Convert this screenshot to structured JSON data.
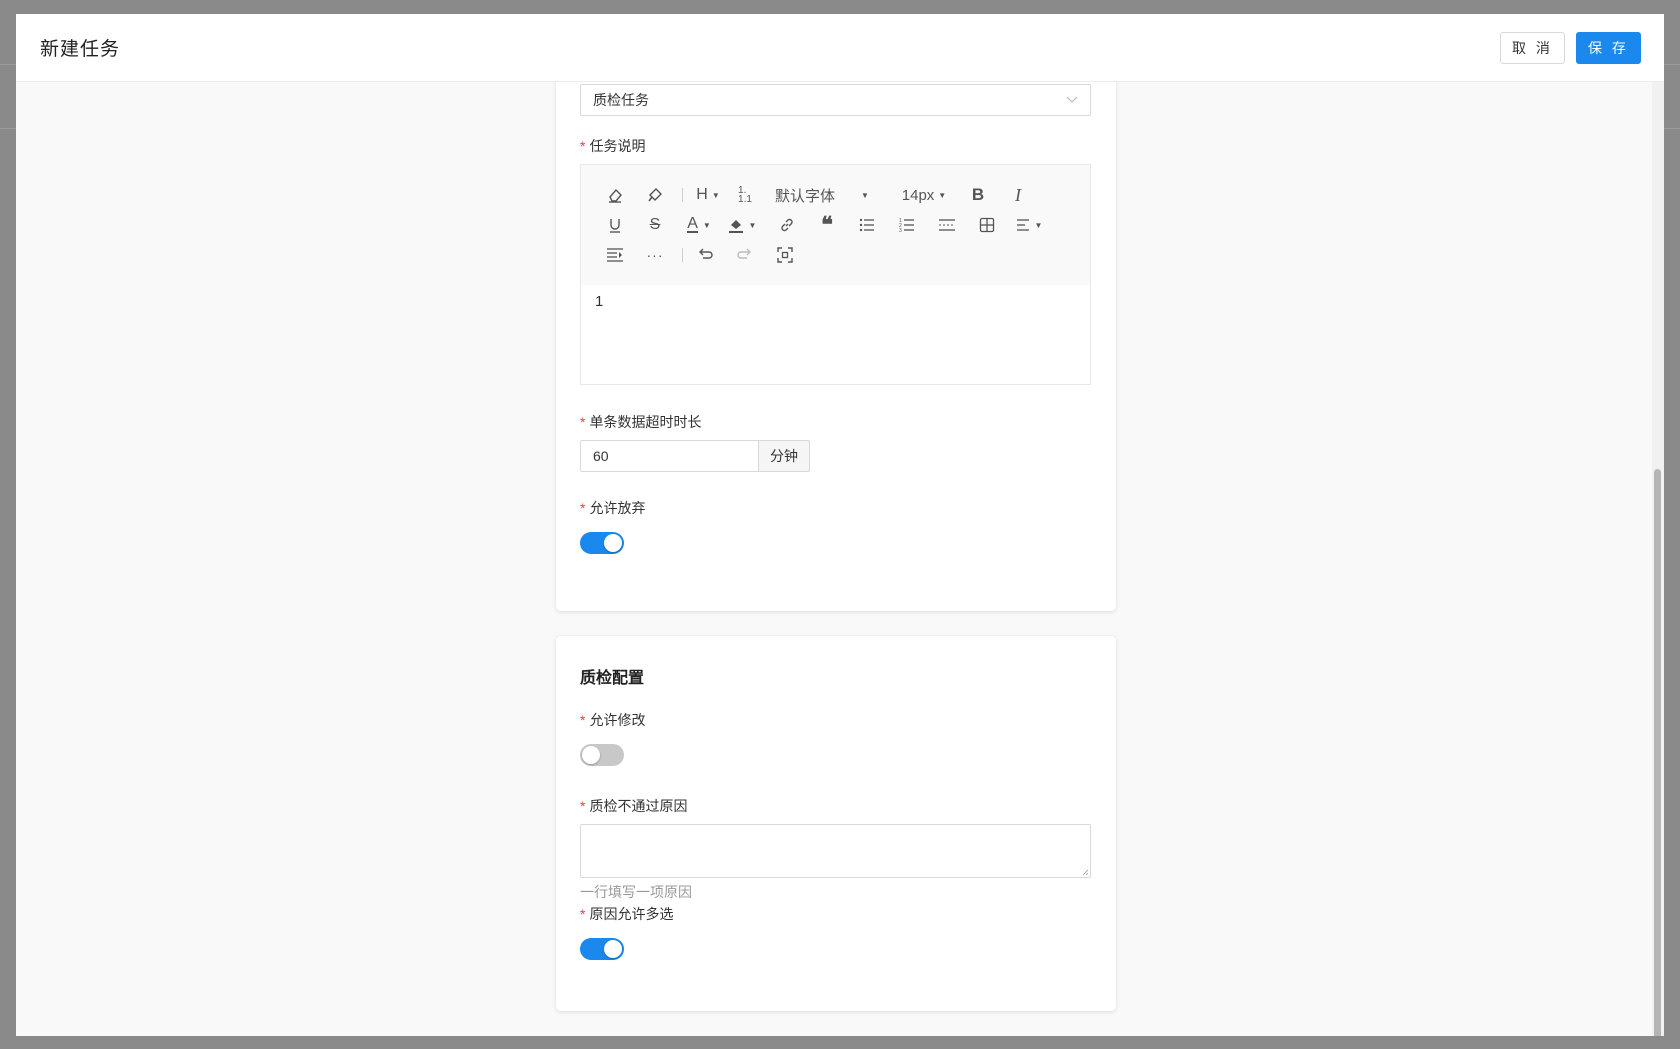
{
  "modal": {
    "title": "新建任务",
    "cancel_label": "取 消",
    "save_label": "保 存"
  },
  "basic": {
    "task_type_value": "质检任务",
    "description_label": "任务说明",
    "editor": {
      "font_family": "默认字体",
      "font_size": "14px",
      "content": "1"
    },
    "timeout_label": "单条数据超时时长",
    "timeout_value": "60",
    "timeout_unit": "分钟",
    "allow_abandon_label": "允许放弃",
    "allow_abandon": true
  },
  "qc_config": {
    "title": "质检配置",
    "allow_modify_label": "允许修改",
    "allow_modify": false,
    "fail_reason_label": "质检不通过原因",
    "fail_reason_value": "",
    "fail_reason_hint": "一行填写一项原因",
    "multi_select_label": "原因允许多选",
    "multi_select": true
  },
  "colors": {
    "primary": "#1b88ee",
    "required": "#e3403d"
  }
}
